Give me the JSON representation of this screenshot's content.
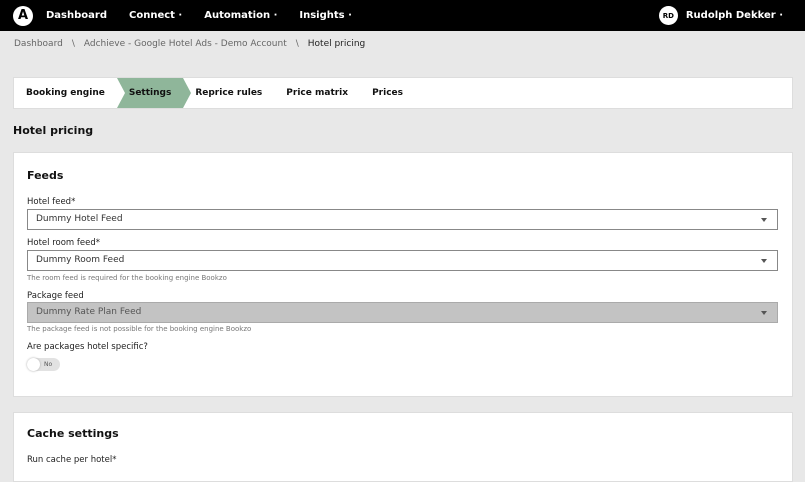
{
  "topbar": {
    "logo": "A",
    "nav": [
      "Dashboard",
      "Connect ·",
      "Automation ·",
      "Insights ·"
    ],
    "user_initials": "RD",
    "user_name": "Rudolph Dekker ·"
  },
  "breadcrumb": [
    "Dashboard",
    "Adchieve - Google Hotel Ads - Demo Account",
    "Hotel pricing"
  ],
  "breadcrumb_sep": "\\",
  "steps": [
    "Booking engine",
    "Settings",
    "Reprice rules",
    "Price matrix",
    "Prices"
  ],
  "page_title": "Hotel pricing",
  "feeds": {
    "title": "Feeds",
    "hotel_feed_label": "Hotel feed*",
    "hotel_feed": "Dummy Hotel Feed",
    "room_feed_label": "Hotel room feed*",
    "room_feed": "Dummy Room Feed",
    "room_help": "The room feed is required for the booking engine Bookzo",
    "package_label": "Package feed",
    "package_feed": "Dummy Rate Plan Feed",
    "package_help": "The package feed is not possible for the booking engine Bookzo",
    "specific_label": "Are packages hotel specific?",
    "toggle_label": "No"
  },
  "cache": {
    "title": "Cache settings",
    "run_label": "Run cache per hotel*"
  }
}
